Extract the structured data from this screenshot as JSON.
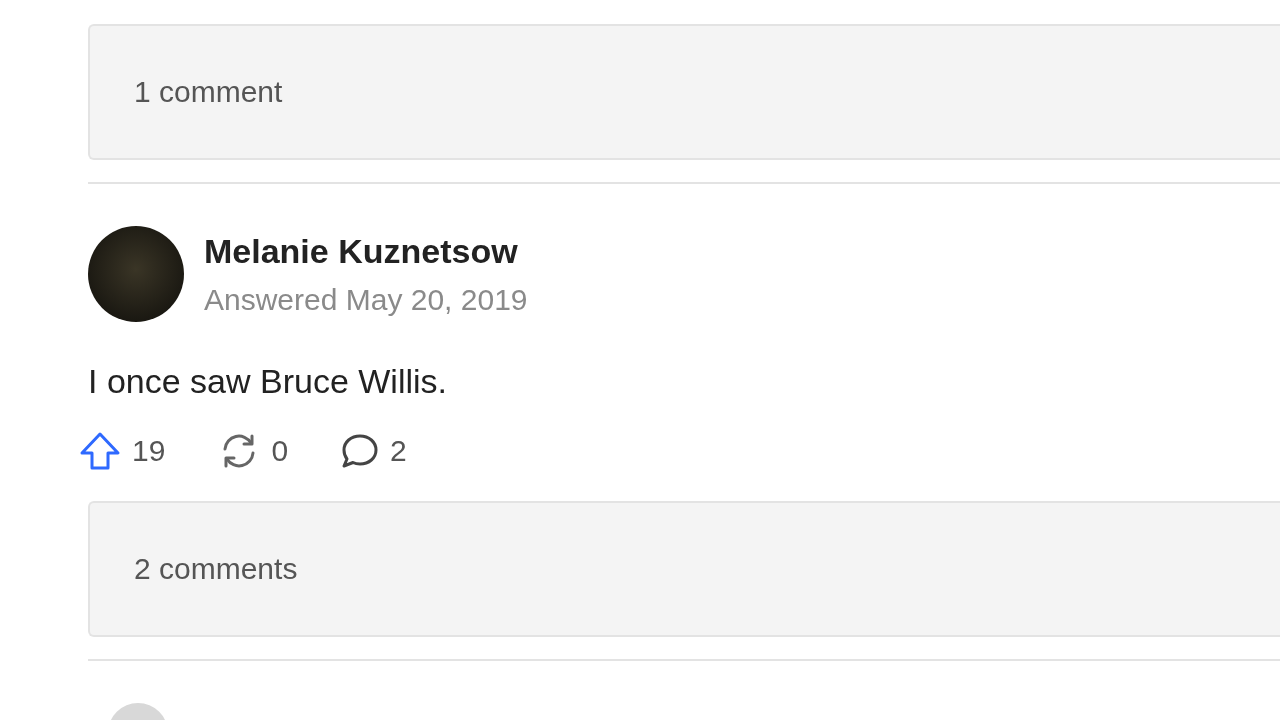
{
  "top_comments": {
    "label": "1 comment"
  },
  "answer": {
    "author": "Melanie Kuznetsow",
    "date": "Answered May 20, 2019",
    "body": "I once saw Bruce Willis.",
    "upvoted": true,
    "upvotes": "19",
    "shares": "0",
    "comments_count": "2",
    "comments_label": "2 comments"
  }
}
